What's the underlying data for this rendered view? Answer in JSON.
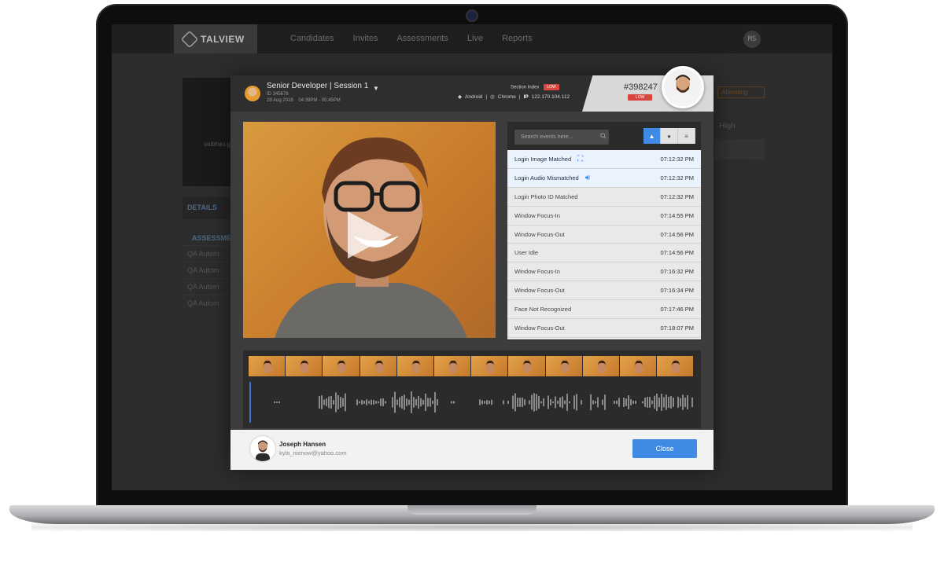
{
  "background_app": {
    "brand": "TALVIEW",
    "nav": [
      "Candidates",
      "Invites",
      "Assessments",
      "Live",
      "Reports"
    ],
    "user_initials": "MS",
    "sidebar_user": "vaibhav.g",
    "details_tab": "DETAILS",
    "assessments_header": "ASSESSME",
    "assessment_rows": [
      "QA Autom",
      "QA Autom",
      "QA Autom",
      "QA Autom"
    ],
    "status_badge": "Attending",
    "priority_label": "High"
  },
  "modal": {
    "session_title": "Senior Developer | Session 1",
    "session_id": "ID 345678",
    "session_date": "29 Aug 2018",
    "session_time": "04:39PM - 05:45PM",
    "section_index_label": "Section Index",
    "section_index_level": "LOW",
    "device_os": "Android",
    "device_browser": "Chrome",
    "ip_label": "IP",
    "ip_value": "122.170.104.112",
    "candidate_number": "#398247",
    "candidate_risk": "LOW",
    "search_placeholder": "Search events here...",
    "events": [
      {
        "label": "Login Image Matched",
        "time": "07:12:32 PM",
        "highlight": true,
        "icon": "face-scan-icon"
      },
      {
        "label": "Login Audio Mismatched",
        "time": "07:12:32 PM",
        "highlight": true,
        "icon": "speaker-icon"
      },
      {
        "label": "Login Photo ID Matched",
        "time": "07:12:32 PM"
      },
      {
        "label": "Window Focus-In",
        "time": "07:14:55 PM"
      },
      {
        "label": "Window Focus-Out",
        "time": "07:14:56 PM"
      },
      {
        "label": "User Idle",
        "time": "07:14:56 PM"
      },
      {
        "label": "Window Focus-In",
        "time": "07:16:32 PM"
      },
      {
        "label": "Window Focus-Out",
        "time": "07:16:34 PM"
      },
      {
        "label": "Face Not Recognized",
        "time": "07:17:46 PM"
      },
      {
        "label": "Window Focus-Out",
        "time": "07:18:07 PM"
      }
    ],
    "footer_name": "Joseph Hansen",
    "footer_email": "kyla_nienow@yahoo.com",
    "close_label": "Close"
  },
  "colors": {
    "accent": "#3f8ae5",
    "risk_low": "#d9463f",
    "video_bg": "#d99a3e"
  }
}
